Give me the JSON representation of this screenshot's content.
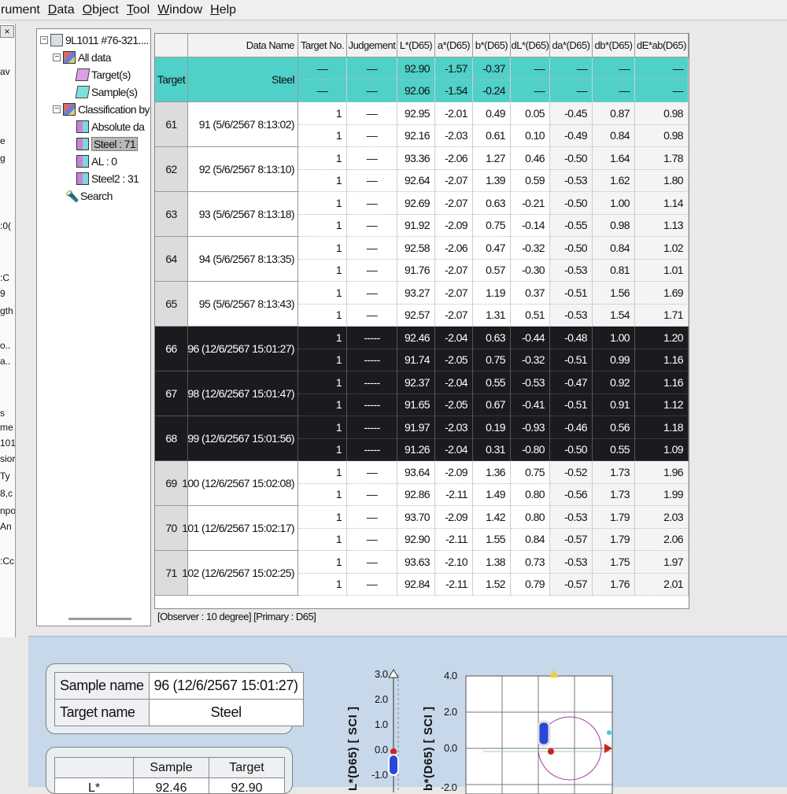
{
  "menu": [
    "rument",
    "Data",
    "Object",
    "Tool",
    "Window",
    "Help"
  ],
  "left_fragments": [
    "av",
    "e",
    "g",
    ":0(",
    ":C",
    "9",
    "gth",
    "o..",
    "a..",
    "s",
    "me",
    "101",
    "sior",
    "Ty",
    "8,c",
    "npo",
    "An",
    ":Cc"
  ],
  "tree": {
    "root": "9L1011 #76-321....",
    "all_data": "All data",
    "targets": "Target(s)",
    "samples": "Sample(s)",
    "classification": "Classification by",
    "absolute": "Absolute da",
    "steel": "Steel : 71",
    "al": "AL : 0",
    "steel2": "Steel2 : 31",
    "search": "Search"
  },
  "table": {
    "headers": [
      "Data Name",
      "Target No.",
      "Judgement",
      "L*(D65)",
      "a*(D65)",
      "b*(D65)",
      "dL*(D65)",
      "da*(D65)",
      "db*(D65)",
      "dE*ab(D65)"
    ],
    "target_row": {
      "label": "Target",
      "name": "Steel",
      "lines": [
        [
          "—",
          "—",
          "92.90",
          "-1.57",
          "-0.37",
          "—",
          "—",
          "—",
          "—"
        ],
        [
          "—",
          "—",
          "92.06",
          "-1.54",
          "-0.24",
          "—",
          "—",
          "—",
          "—"
        ]
      ]
    },
    "groups": [
      {
        "no": "61",
        "name": "91 (5/6/2567 8:13:02)",
        "dark": false,
        "lines": [
          [
            "1",
            "—",
            "92.95",
            "-2.01",
            "0.49",
            "0.05",
            "-0.45",
            "0.87",
            "0.98"
          ],
          [
            "1",
            "—",
            "92.16",
            "-2.03",
            "0.61",
            "0.10",
            "-0.49",
            "0.84",
            "0.98"
          ]
        ]
      },
      {
        "no": "62",
        "name": "92 (5/6/2567 8:13:10)",
        "dark": false,
        "lines": [
          [
            "1",
            "—",
            "93.36",
            "-2.06",
            "1.27",
            "0.46",
            "-0.50",
            "1.64",
            "1.78"
          ],
          [
            "1",
            "—",
            "92.64",
            "-2.07",
            "1.39",
            "0.59",
            "-0.53",
            "1.62",
            "1.80"
          ]
        ]
      },
      {
        "no": "63",
        "name": "93 (5/6/2567 8:13:18)",
        "dark": false,
        "lines": [
          [
            "1",
            "—",
            "92.69",
            "-2.07",
            "0.63",
            "-0.21",
            "-0.50",
            "1.00",
            "1.14"
          ],
          [
            "1",
            "—",
            "91.92",
            "-2.09",
            "0.75",
            "-0.14",
            "-0.55",
            "0.98",
            "1.13"
          ]
        ]
      },
      {
        "no": "64",
        "name": "94 (5/6/2567 8:13:35)",
        "dark": false,
        "lines": [
          [
            "1",
            "—",
            "92.58",
            "-2.06",
            "0.47",
            "-0.32",
            "-0.50",
            "0.84",
            "1.02"
          ],
          [
            "1",
            "—",
            "91.76",
            "-2.07",
            "0.57",
            "-0.30",
            "-0.53",
            "0.81",
            "1.01"
          ]
        ]
      },
      {
        "no": "65",
        "name": "95 (5/6/2567 8:13:43)",
        "dark": false,
        "lines": [
          [
            "1",
            "—",
            "93.27",
            "-2.07",
            "1.19",
            "0.37",
            "-0.51",
            "1.56",
            "1.69"
          ],
          [
            "1",
            "—",
            "92.57",
            "-2.07",
            "1.31",
            "0.51",
            "-0.53",
            "1.54",
            "1.71"
          ]
        ]
      },
      {
        "no": "66",
        "name": "96 (12/6/2567 15:01:27)",
        "dark": true,
        "lines": [
          [
            "1",
            "-----",
            "92.46",
            "-2.04",
            "0.63",
            "-0.44",
            "-0.48",
            "1.00",
            "1.20"
          ],
          [
            "1",
            "-----",
            "91.74",
            "-2.05",
            "0.75",
            "-0.32",
            "-0.51",
            "0.99",
            "1.16"
          ]
        ]
      },
      {
        "no": "67",
        "name": "98 (12/6/2567 15:01:47)",
        "dark": true,
        "lines": [
          [
            "1",
            "-----",
            "92.37",
            "-2.04",
            "0.55",
            "-0.53",
            "-0.47",
            "0.92",
            "1.16"
          ],
          [
            "1",
            "-----",
            "91.65",
            "-2.05",
            "0.67",
            "-0.41",
            "-0.51",
            "0.91",
            "1.12"
          ]
        ]
      },
      {
        "no": "68",
        "name": "99 (12/6/2567 15:01:56)",
        "dark": true,
        "lines": [
          [
            "1",
            "-----",
            "91.97",
            "-2.03",
            "0.19",
            "-0.93",
            "-0.46",
            "0.56",
            "1.18"
          ],
          [
            "1",
            "-----",
            "91.26",
            "-2.04",
            "0.31",
            "-0.80",
            "-0.50",
            "0.55",
            "1.09"
          ]
        ]
      },
      {
        "no": "69",
        "name": "100 (12/6/2567 15:02:08)",
        "dark": false,
        "lines": [
          [
            "1",
            "—",
            "93.64",
            "-2.09",
            "1.36",
            "0.75",
            "-0.52",
            "1.73",
            "1.96"
          ],
          [
            "1",
            "—",
            "92.86",
            "-2.11",
            "1.49",
            "0.80",
            "-0.56",
            "1.73",
            "1.99"
          ]
        ]
      },
      {
        "no": "70",
        "name": "101 (12/6/2567 15:02:17)",
        "dark": false,
        "lines": [
          [
            "1",
            "—",
            "93.70",
            "-2.09",
            "1.42",
            "0.80",
            "-0.53",
            "1.79",
            "2.03"
          ],
          [
            "1",
            "—",
            "92.90",
            "-2.11",
            "1.55",
            "0.84",
            "-0.57",
            "1.79",
            "2.06"
          ]
        ]
      },
      {
        "no": "71",
        "name": "102 (12/6/2567 15:02:25)",
        "dark": false,
        "lines": [
          [
            "1",
            "—",
            "93.63",
            "-2.10",
            "1.38",
            "0.73",
            "-0.53",
            "1.75",
            "1.97"
          ],
          [
            "1",
            "—",
            "92.84",
            "-2.11",
            "1.52",
            "0.79",
            "-0.57",
            "1.76",
            "2.01"
          ]
        ]
      }
    ]
  },
  "observer": "[Observer : 10 degree]  [Primary : D65]",
  "info": {
    "sample_name_label": "Sample name",
    "sample_name": "96 (12/6/2567 15:01:27)",
    "target_name_label": "Target name",
    "target_name": "Steel",
    "col_sample": "Sample",
    "col_target": "Target",
    "row_label": "L*",
    "sample_val": "92.46",
    "target_val": "92.90"
  },
  "plots": {
    "l_label": "L*(D65) [ SCI ]",
    "b_label": "b*(D65) [ SCI ]",
    "l_ticks": [
      "3.0",
      "2.0",
      "1.0",
      "0.0",
      "-1.0"
    ],
    "b_ticks": [
      "4.0",
      "2.0",
      "0.0",
      "-2.0"
    ]
  },
  "colors": {
    "target_row": "#4fd0c8",
    "selected_rows": "#1b1b1f",
    "bottom_panel": "#c6d8ea"
  }
}
